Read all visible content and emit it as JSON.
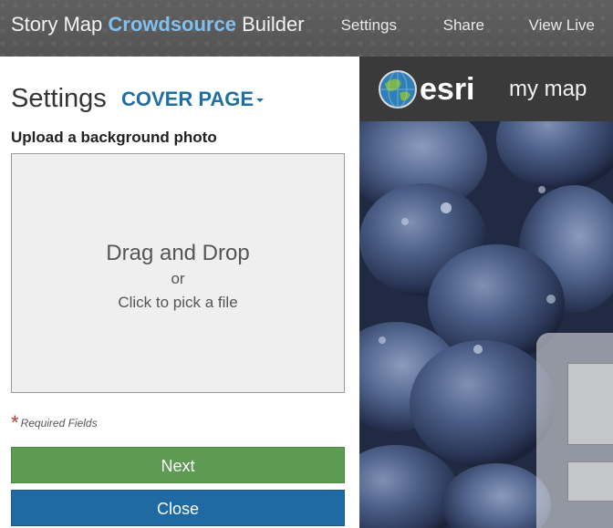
{
  "app": {
    "title_prefix": "Story Map ",
    "title_accent": "Crowdsource",
    "title_suffix": " Builder"
  },
  "nav": {
    "settings": "Settings",
    "share": "Share",
    "view_live": "View Live"
  },
  "panel": {
    "title": "Settings",
    "section": "COVER PAGE",
    "upload_label": "Upload a background photo",
    "dropzone": {
      "main": "Drag and Drop",
      "or": "or",
      "pick": "Click to pick a file"
    },
    "required_star": "*",
    "required_text": "Required Fields",
    "next_label": "Next",
    "close_label": "Close"
  },
  "preview": {
    "logo_text": "esri",
    "map_title": "my map"
  },
  "colors": {
    "accent": "#7fc0ee",
    "section": "#1d6fa5",
    "next": "#5d9b53",
    "close": "#1f6aa3",
    "required": "#c0392b"
  }
}
